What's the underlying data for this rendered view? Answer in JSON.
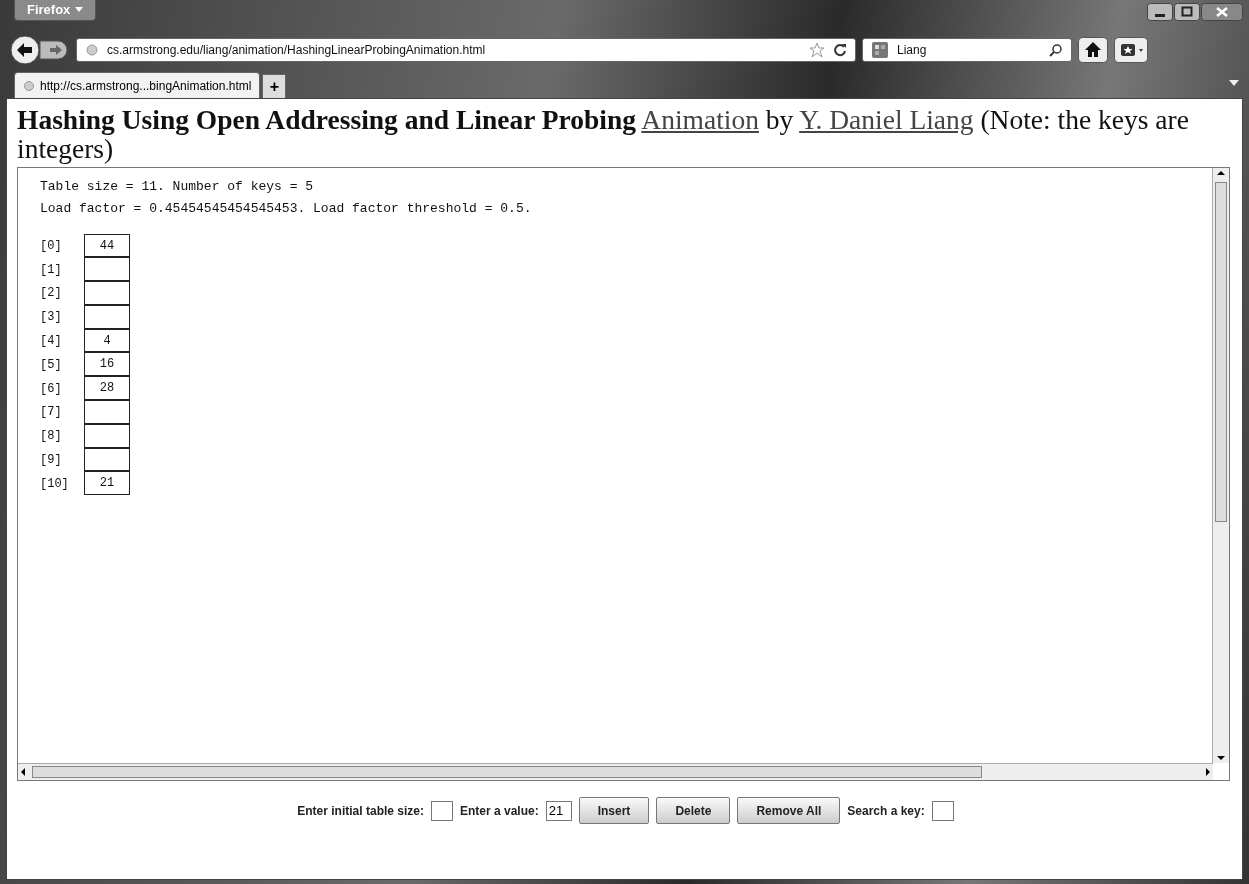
{
  "browser": {
    "menu_button": "Firefox",
    "address": "cs.armstrong.edu/liang/animation/HashingLinearProbingAnimation.html",
    "search": "Liang",
    "tab": "http://cs.armstrong...bingAnimation.html",
    "new_tab": "+"
  },
  "heading": {
    "title": "Hashing Using Open Addressing and Linear Probing",
    "link": "Animation",
    "by": "by",
    "author": "Y. Daniel Liang",
    "note": "(Note: the keys are integers)"
  },
  "applet": {
    "info": [
      "Table size = 11. Number of keys = 5",
      "Load factor = 0.45454545454545453. Load factor threshold = 0.5."
    ],
    "slots": [
      {
        "index": "[0]",
        "value": "44"
      },
      {
        "index": "[1]"
      },
      {
        "index": "[2]"
      },
      {
        "index": "[3]"
      },
      {
        "index": "[4]",
        "value": "4"
      },
      {
        "index": "[5]",
        "value": "16"
      },
      {
        "index": "[6]",
        "value": "28"
      },
      {
        "index": "[7]"
      },
      {
        "index": "[8]"
      },
      {
        "index": "[9]"
      },
      {
        "index": "[10]",
        "value": "21"
      }
    ]
  },
  "controls": [
    {
      "kind": "field",
      "label": "Enter initial table size:"
    },
    {
      "kind": "field",
      "label": "Enter a value:",
      "value": "21"
    },
    {
      "kind": "button",
      "label": "Insert"
    },
    {
      "kind": "button",
      "label": "Delete"
    },
    {
      "kind": "button",
      "label": "Remove All"
    },
    {
      "kind": "field",
      "label": "Search a key:"
    }
  ]
}
